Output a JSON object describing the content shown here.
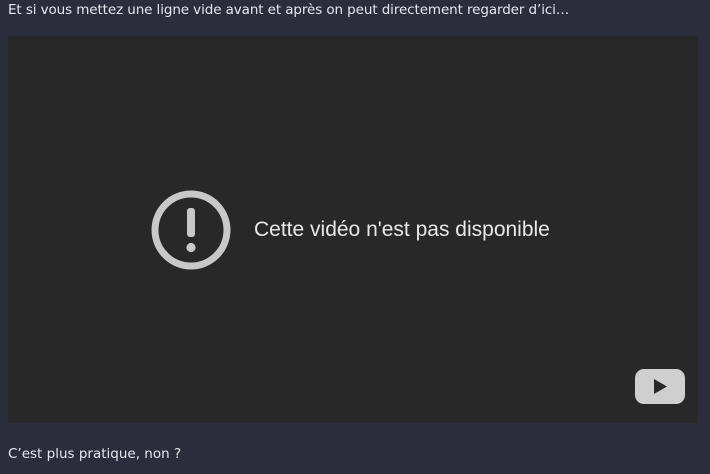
{
  "post": {
    "intro_text": "Et si vous mettez une ligne vide avant et après on peut directement regarder d’ici…",
    "outro_text": "C’est plus pratique, non ?"
  },
  "video": {
    "error_message": "Cette vidéo n'est pas disponible",
    "error_icon": "exclamation-circle-icon",
    "play_icon": "youtube-play-icon",
    "background_color": "#282828",
    "icon_color": "#c8c8c8"
  }
}
